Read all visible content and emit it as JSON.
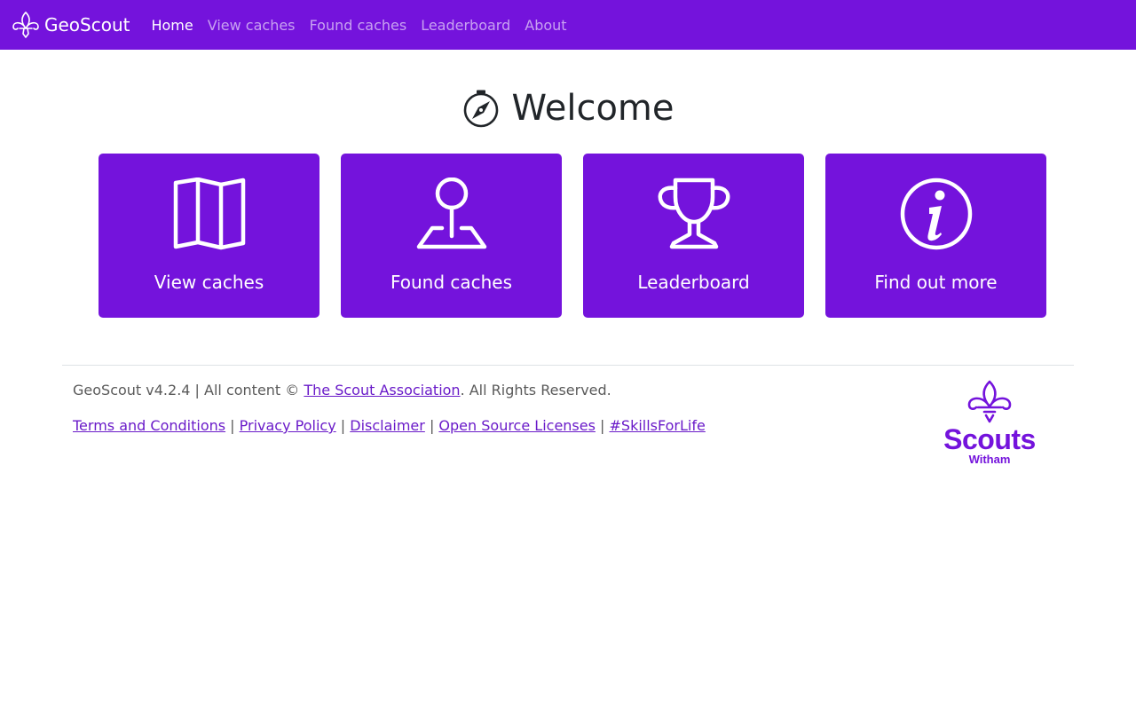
{
  "navbar": {
    "brand": "GeoScout",
    "links": [
      {
        "label": "Home",
        "active": true
      },
      {
        "label": "View caches",
        "active": false
      },
      {
        "label": "Found caches",
        "active": false
      },
      {
        "label": "Leaderboard",
        "active": false
      },
      {
        "label": "About",
        "active": false
      }
    ]
  },
  "main": {
    "title": "Welcome",
    "cards": [
      {
        "label": "View caches",
        "icon": "map-icon"
      },
      {
        "label": "Found caches",
        "icon": "map-pin-icon"
      },
      {
        "label": "Leaderboard",
        "icon": "trophy-icon"
      },
      {
        "label": "Find out more",
        "icon": "info-icon"
      }
    ]
  },
  "footer": {
    "version_text": "GeoScout v4.2.4 | All content © ",
    "association_link": "The Scout Association",
    "rights_text": ". All Rights Reserved.",
    "links": [
      "Terms and Conditions",
      "Privacy Policy",
      "Disclaimer",
      "Open Source Licenses",
      "#SkillsForLife"
    ],
    "separator": " | ",
    "logo_word": "Scouts",
    "logo_sub": "Witham"
  },
  "colors": {
    "brand": "#7413dc",
    "link": "#6a1bc9"
  }
}
